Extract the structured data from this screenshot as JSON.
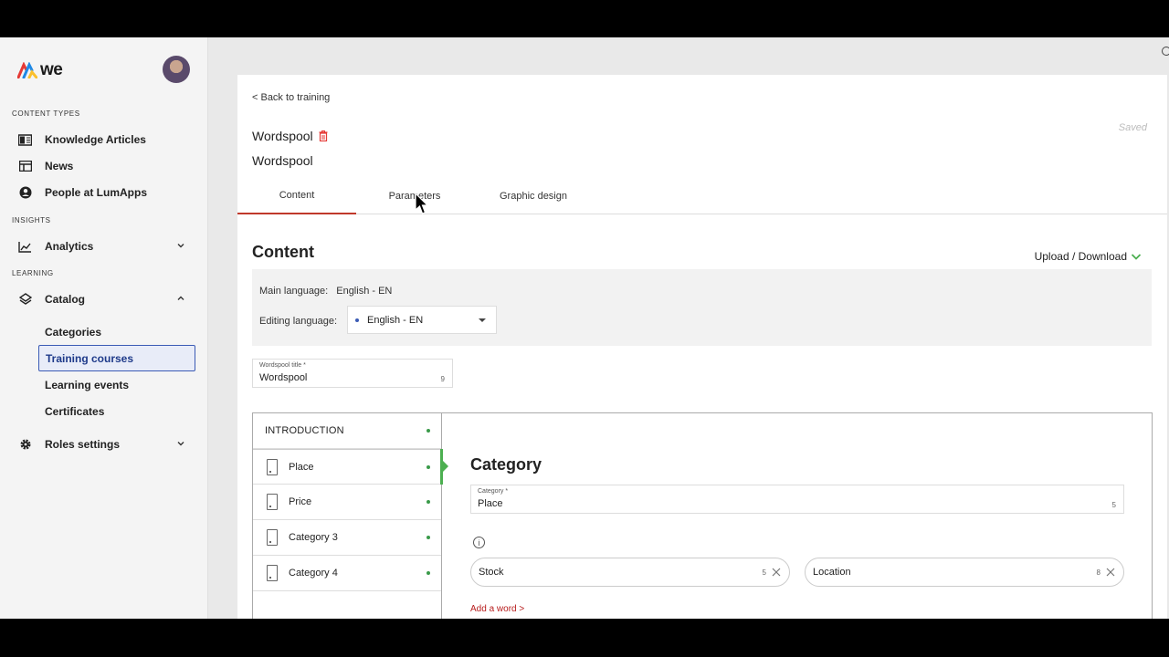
{
  "logo": {
    "text": "we"
  },
  "sidebar": {
    "sections": {
      "content_types": "CONTENT TYPES",
      "insights": "INSIGHTS",
      "learning": "LEARNING"
    },
    "items": {
      "knowledge": "Knowledge Articles",
      "news": "News",
      "people": "People at LumApps",
      "analytics": "Analytics",
      "catalog": "Catalog",
      "roles": "Roles settings"
    },
    "catalog_sub": [
      "Categories",
      "Training courses",
      "Learning events",
      "Certificates"
    ],
    "active_sub": "Training courses"
  },
  "panel": {
    "back": "< Back to training",
    "saved": "Saved",
    "title": "Wordspool",
    "subtitle": "Wordspool",
    "tabs": [
      "Content",
      "Parameters",
      "Graphic design"
    ],
    "active_tab": "Content",
    "content_heading": "Content",
    "upload_download": "Upload / Download",
    "main_language_label": "Main language:",
    "main_language_value": "English - EN",
    "editing_language_label": "Editing language:",
    "editing_language_value": "English - EN",
    "title_field": {
      "label": "Wordspool title *",
      "value": "Wordspool",
      "count": "9"
    }
  },
  "editor": {
    "list": [
      {
        "label": "INTRODUCTION",
        "type": "intro"
      },
      {
        "label": "Place",
        "type": "card"
      },
      {
        "label": "Price",
        "type": "card"
      },
      {
        "label": "Category 3",
        "type": "card"
      },
      {
        "label": "Category 4",
        "type": "card"
      }
    ],
    "selected": "Place",
    "category_heading": "Category",
    "category_field": {
      "label": "Category *",
      "value": "Place",
      "count": "5"
    },
    "words": [
      {
        "value": "Stock",
        "count": "5"
      },
      {
        "value": "Location",
        "count": "8"
      }
    ],
    "add_word": "Add a word >"
  },
  "colors": {
    "accent_red": "#c0392b",
    "accent_green": "#4caf50",
    "active_blue": "#3b5bb5"
  }
}
